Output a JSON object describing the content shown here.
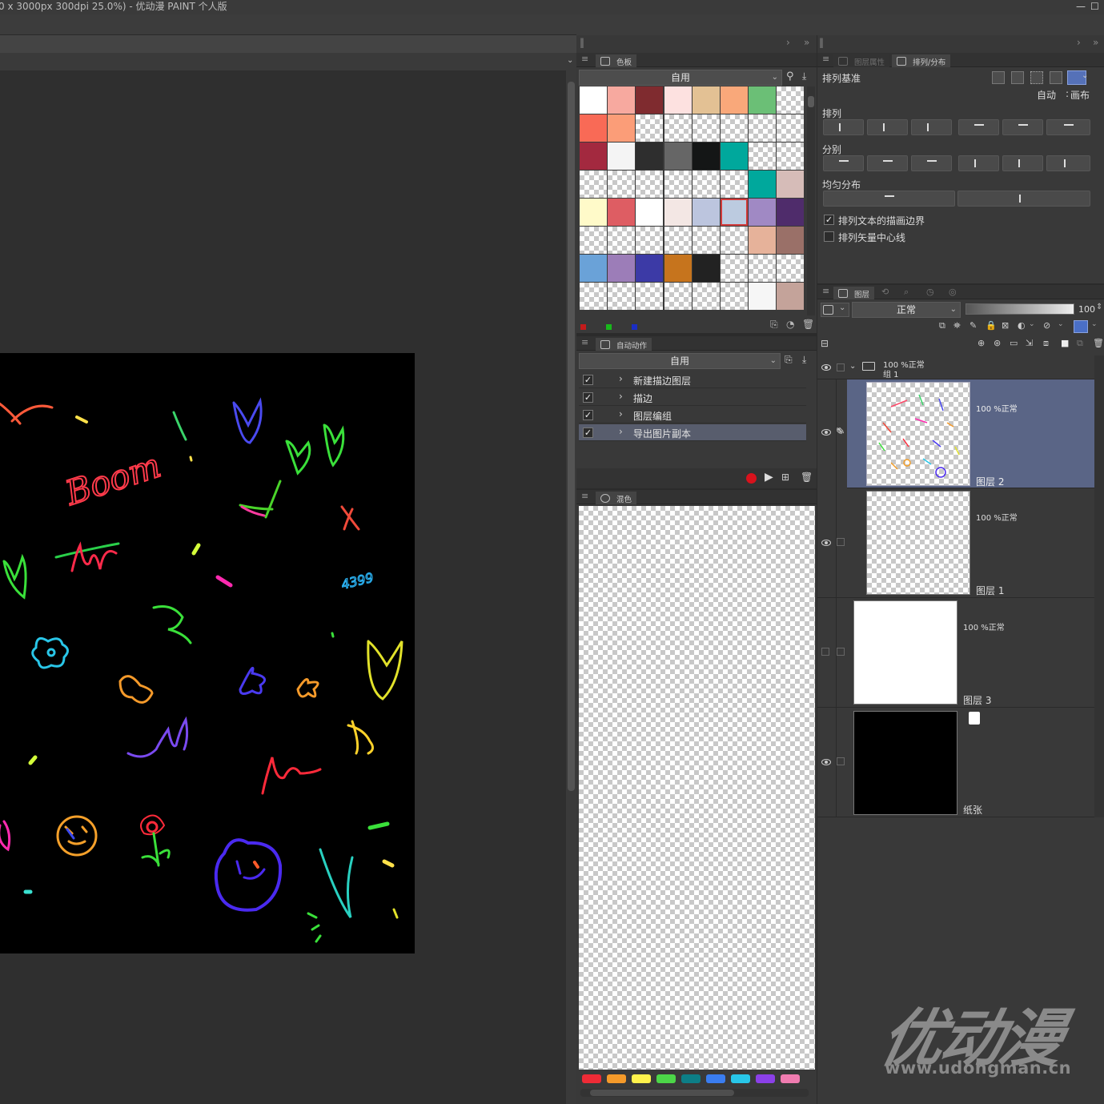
{
  "title": "0 x 3000px 300dpi 25.0%)  - 优动漫 PAINT 个人版",
  "palette": {
    "tab": "色板",
    "set": "自用",
    "colors": [
      [
        "#ffffff",
        "#f7a99f",
        "#7f2b2f",
        "#fde1e0",
        "#e3c194",
        "#f9a87a",
        "#6bbf76",
        "chk"
      ],
      [
        "#f96a56",
        "#fb9d78",
        "chk",
        "chk",
        "chk",
        "chk",
        "chk",
        "chk"
      ],
      [
        "#a3293f",
        "#f4f4f4",
        "#2e2e2e",
        "#666666",
        "#141616",
        "#00a89c",
        "chk",
        "chk"
      ],
      [
        "chk",
        "chk",
        "chk",
        "chk",
        "chk",
        "chk",
        "#00a89c",
        "#d6bcb8"
      ],
      [
        "#fffac9",
        "#de5d63",
        "#ffffff",
        "#f3e7e4",
        "#bcc5de",
        "#bccbe0",
        "#a089c4",
        "#4f2c6b"
      ],
      [
        "chk",
        "chk",
        "chk",
        "chk",
        "chk",
        "chk",
        "#e6b29a",
        "#9a7068"
      ],
      [
        "#6aa2d8",
        "#9c7db8",
        "#3c3aa6",
        "#c6741d",
        "#222222",
        "chk",
        "chk",
        "chk"
      ],
      [
        "chk",
        "chk",
        "chk",
        "chk",
        "chk",
        "chk",
        "#f6f6f6",
        "#c4a39a"
      ]
    ]
  },
  "autoaction": {
    "tab": "自动动作",
    "set": "自用",
    "items": [
      "新建描边图层",
      "描边",
      "图层编组",
      "导出图片副本"
    ]
  },
  "mix": {
    "tab": "混色",
    "colors": [
      "#ee2b36",
      "#f59a2a",
      "#fff24c",
      "#4cd648",
      "#0c7e86",
      "#3a7df0",
      "#28c6e8",
      "#8b40e8",
      "#f07cb0"
    ]
  },
  "align": {
    "tab_inactive": "图层属性",
    "tab": "排列/分布",
    "base_label": "排列基准",
    "auto": "自动",
    "colon": ":",
    "canvas": "画布",
    "align_label": "排列",
    "distribute_label": "分别",
    "even_label": "均匀分布",
    "opt1": "排列文本的描画边界",
    "opt2": "排列矢量中心线"
  },
  "layers": {
    "tab": "图层",
    "blend": "正常",
    "opacity": "100",
    "group": {
      "pct": "100 %正常",
      "name": "组 1"
    },
    "items": [
      {
        "pct": "100 %正常",
        "name": "图层 2"
      },
      {
        "pct": "100 %正常",
        "name": "图层 1"
      },
      {
        "pct": "100 %正常",
        "name": "图层 3"
      },
      {
        "pct": "",
        "name": "纸张"
      }
    ]
  },
  "canvas_text": {
    "boom": "Boom",
    "num": "4399"
  },
  "watermark": {
    "logo": "优动漫",
    "url": "www.udongman.cn"
  }
}
